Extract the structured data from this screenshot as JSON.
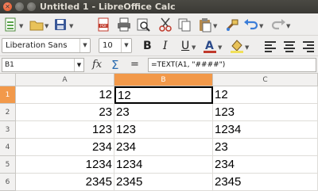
{
  "window": {
    "title": "Untitled 1 - LibreOffice Calc"
  },
  "font": {
    "name": "Liberation Sans",
    "size": "10"
  },
  "formula_bar": {
    "name_box": "B1",
    "formula": "=TEXT(A1, \"####\")"
  },
  "columns": [
    "A",
    "B",
    "C"
  ],
  "active_column": "B",
  "active_row": "1",
  "rows": [
    {
      "num": "1",
      "a": "12",
      "b": "12",
      "c": "12"
    },
    {
      "num": "2",
      "a": "23",
      "b": "23",
      "c": "123"
    },
    {
      "num": "3",
      "a": "123",
      "b": "123",
      "c": "1234"
    },
    {
      "num": "4",
      "a": "234",
      "b": "234",
      "c": "23"
    },
    {
      "num": "5",
      "a": "1234",
      "b": "1234",
      "c": "234"
    },
    {
      "num": "6",
      "a": "2345",
      "b": "2345",
      "c": "2345"
    }
  ],
  "colors": {
    "accent": "#f2994a",
    "titlebar": "#3c3b37",
    "close_button": "#e0521f"
  },
  "icons": {
    "toolbar": [
      "new-document-icon",
      "open-folder-icon",
      "save-icon",
      "export-pdf-icon",
      "print-icon",
      "print-preview-icon",
      "cut-icon",
      "copy-icon",
      "paste-icon",
      "clone-formatting-icon",
      "undo-icon",
      "redo-icon"
    ],
    "formatting": [
      "bold-icon",
      "italic-icon",
      "underline-icon",
      "font-color-icon",
      "highlight-icon",
      "align-left-icon",
      "align-center-icon",
      "align-right-icon"
    ],
    "formula": [
      "function-wizard-icon",
      "sum-icon",
      "formula-icon"
    ]
  }
}
